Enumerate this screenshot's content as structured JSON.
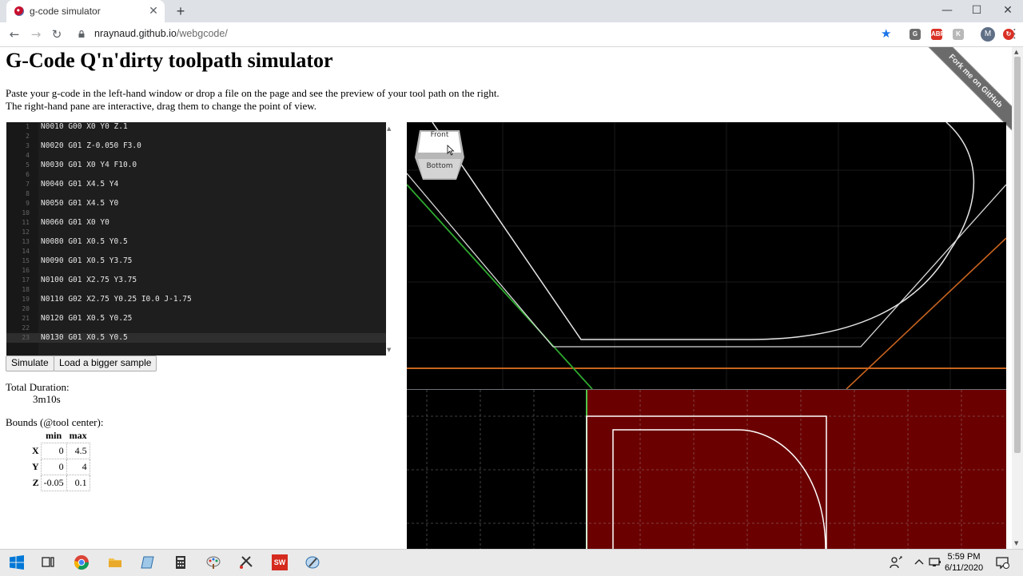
{
  "browser": {
    "tab_title": "g-code simulator",
    "tab_close": "✕",
    "new_tab": "+",
    "url_host": "nraynaud.github.io",
    "url_path": "/webgcode/",
    "window_minimize": "—",
    "window_maximize": "☐",
    "window_close": "✕",
    "back": "←",
    "forward": "→",
    "reload": "↻",
    "bookmark_star": "★",
    "kebab": "⋮",
    "profile_initial": "M",
    "extensions": [
      {
        "label": "G",
        "color": "#6d6d6d"
      },
      {
        "label": "ABP",
        "color": "#d93025"
      },
      {
        "label": "K",
        "color": "#b8b8b8"
      },
      {
        "label": "↻",
        "color": "#d93025"
      }
    ]
  },
  "page": {
    "title": "G-Code Q'n'dirty toolpath simulator",
    "intro_line1": "Paste your g-code in the left-hand window or drop a file on the page and see the preview of your tool path on the right.",
    "intro_line2": "The right-hand pane are interactive, drag them to change the point of view.",
    "fork_ribbon": "Fork me on GitHub"
  },
  "editor": {
    "lines": [
      {
        "n": "1",
        "code": "N0010 G00 X0 Y0 Z.1"
      },
      {
        "n": "2",
        "code": ""
      },
      {
        "n": "3",
        "code": "N0020 G01 Z-0.050 F3.0"
      },
      {
        "n": "4",
        "code": ""
      },
      {
        "n": "5",
        "code": "N0030 G01 X0 Y4 F10.0"
      },
      {
        "n": "6",
        "code": ""
      },
      {
        "n": "7",
        "code": "N0040 G01 X4.5 Y4"
      },
      {
        "n": "8",
        "code": ""
      },
      {
        "n": "9",
        "code": "N0050 G01 X4.5 Y0"
      },
      {
        "n": "10",
        "code": ""
      },
      {
        "n": "11",
        "code": "N0060 G01 X0 Y0"
      },
      {
        "n": "12",
        "code": ""
      },
      {
        "n": "13",
        "code": "N0080 G01 X0.5 Y0.5"
      },
      {
        "n": "14",
        "code": ""
      },
      {
        "n": "15",
        "code": "N0090 G01 X0.5 Y3.75"
      },
      {
        "n": "16",
        "code": ""
      },
      {
        "n": "17",
        "code": "N0100 G01 X2.75 Y3.75"
      },
      {
        "n": "18",
        "code": ""
      },
      {
        "n": "19",
        "code": "N0110 G02 X2.75 Y0.25 I0.0 J-1.75"
      },
      {
        "n": "20",
        "code": ""
      },
      {
        "n": "21",
        "code": "N0120 G01 X0.5 Y0.25"
      },
      {
        "n": "22",
        "code": ""
      },
      {
        "n": "23",
        "code": "N0130 G01 X0.5 Y0.5"
      }
    ]
  },
  "buttons": {
    "simulate": "Simulate",
    "load_sample": "Load a bigger sample"
  },
  "stats": {
    "duration_label": "Total Duration:",
    "duration_value": "3m10s",
    "bounds_label": "Bounds (@tool center):",
    "col_min": "min",
    "col_max": "max",
    "rows": [
      {
        "axis": "X",
        "min": "0",
        "max": "4.5"
      },
      {
        "axis": "Y",
        "min": "0",
        "max": "4"
      },
      {
        "axis": "Z",
        "min": "-0.05",
        "max": "0.1"
      }
    ]
  },
  "viewcube": {
    "front": "Front",
    "bottom": "Bottom"
  },
  "taskbar": {
    "time": "5:59 PM",
    "date": "6/11/2020"
  },
  "colors": {
    "editor_bg": "#1e1e1e",
    "stock_red": "#6b0000",
    "toolpath": "#e6e6e6",
    "x_axis": "#d2691e",
    "y_axis": "#2ea82e"
  }
}
